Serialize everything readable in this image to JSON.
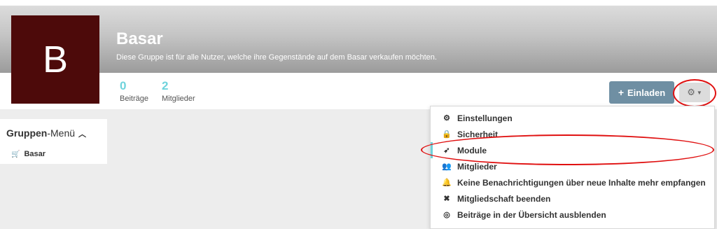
{
  "group": {
    "avatar_letter": "B",
    "avatar_color": "#4d0a0a",
    "title": "Basar",
    "description": "Diese Gruppe ist für alle Nutzer, welche ihre Gegenstände auf dem Basar verkaufen möchten."
  },
  "stats": [
    {
      "value": "0",
      "label": "Beiträge"
    },
    {
      "value": "2",
      "label": "Mitglieder"
    }
  ],
  "actions": {
    "invite_label": "Einladen",
    "invite_icon": "plus-icon",
    "settings_icon": "gear-icon"
  },
  "sidebar": {
    "title_bold": "Gruppen",
    "title_rest": "-Menü",
    "items": [
      {
        "label": "Basar",
        "icon": "cart-icon"
      }
    ]
  },
  "dropdown": {
    "items": [
      {
        "label": "Einstellungen",
        "icon": "cogs-icon"
      },
      {
        "label": "Sicherheit",
        "icon": "lock-icon"
      },
      {
        "label": "Module",
        "icon": "rocket-icon",
        "active": true
      },
      {
        "label": "Mitglieder",
        "icon": "users-icon"
      },
      {
        "label": "Keine Benachrichtigungen über neue Inhalte mehr empfangen",
        "icon": "bell-icon"
      },
      {
        "label": "Mitgliedschaft beenden",
        "icon": "times-icon"
      },
      {
        "label": "Beiträge in der Übersicht ausblenden",
        "icon": "eye-slash-icon"
      }
    ]
  },
  "colors": {
    "accent": "#6fd3dc",
    "invite_button": "#6f8fa3",
    "highlight_circle": "#e01010"
  }
}
